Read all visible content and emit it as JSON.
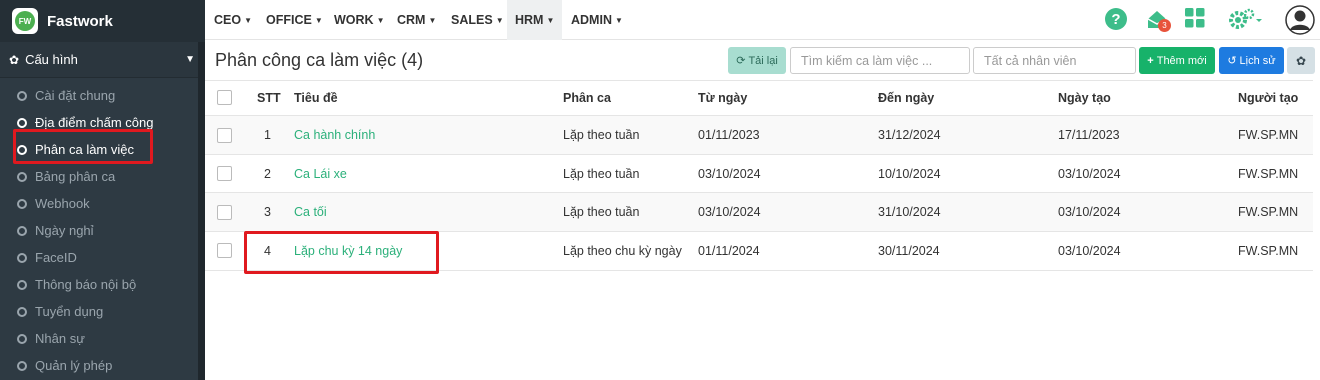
{
  "brand": {
    "name": "Fastwork",
    "logo_text": "FW"
  },
  "sidebar": {
    "section_label": "Cấu hình",
    "items": [
      {
        "label": "Cài đặt chung"
      },
      {
        "label": "Địa điểm chấm công"
      },
      {
        "label": "Phân ca làm việc"
      },
      {
        "label": "Bảng phân ca"
      },
      {
        "label": "Webhook"
      },
      {
        "label": "Ngày nghỉ"
      },
      {
        "label": "FaceID"
      },
      {
        "label": "Thông báo nội bộ"
      },
      {
        "label": "Tuyển dụng"
      },
      {
        "label": "Nhân sự"
      },
      {
        "label": "Quản lý phép"
      }
    ]
  },
  "topnav": {
    "items": [
      {
        "label": "CEO"
      },
      {
        "label": "OFFICE"
      },
      {
        "label": "WORK"
      },
      {
        "label": "CRM"
      },
      {
        "label": "SALES"
      },
      {
        "label": "HRM"
      },
      {
        "label": "ADMIN"
      }
    ],
    "notification_count": "3",
    "icons": [
      "help-icon",
      "notification-icon",
      "apps-grid-icon",
      "settings-icon",
      "user-avatar-icon"
    ]
  },
  "page": {
    "title": "Phân công ca làm việc (4)",
    "reload_label": "Tải lại",
    "search_placeholder": "Tìm kiếm ca làm việc ...",
    "employee_filter_placeholder": "Tất cả nhân viên",
    "add_label": "Thêm mới",
    "history_label": "Lịch sử"
  },
  "table": {
    "headers": {
      "stt": "STT",
      "title": "Tiêu đề",
      "shift": "Phân ca",
      "from": "Từ ngày",
      "to": "Đến ngày",
      "created": "Ngày tạo",
      "creator": "Người tạo"
    },
    "rows": [
      {
        "stt": "1",
        "title": "Ca hành chính",
        "shift": "Lặp theo tuần",
        "from": "01/11/2023",
        "to": "31/12/2024",
        "created": "17/11/2023",
        "creator": "FW.SP.MN"
      },
      {
        "stt": "2",
        "title": "Ca Lái xe",
        "shift": "Lặp theo tuần",
        "from": "03/10/2024",
        "to": "10/10/2024",
        "created": "03/10/2024",
        "creator": "FW.SP.MN"
      },
      {
        "stt": "3",
        "title": "Ca tối",
        "shift": "Lặp theo tuần",
        "from": "03/10/2024",
        "to": "31/10/2024",
        "created": "03/10/2024",
        "creator": "FW.SP.MN"
      },
      {
        "stt": "4",
        "title": "Lặp chu kỳ 14 ngày",
        "shift": "Lặp theo chu kỳ ngày",
        "from": "01/11/2024",
        "to": "30/11/2024",
        "created": "03/10/2024",
        "creator": "FW.SP.MN"
      }
    ]
  },
  "colors": {
    "accent_green": "#2bb07a",
    "add_button": "#17b26a",
    "history_button": "#1e7be0",
    "reload_button": "#a8ddd0",
    "highlight_red": "#e0191f",
    "sidebar_bg": "#2e3a43"
  }
}
